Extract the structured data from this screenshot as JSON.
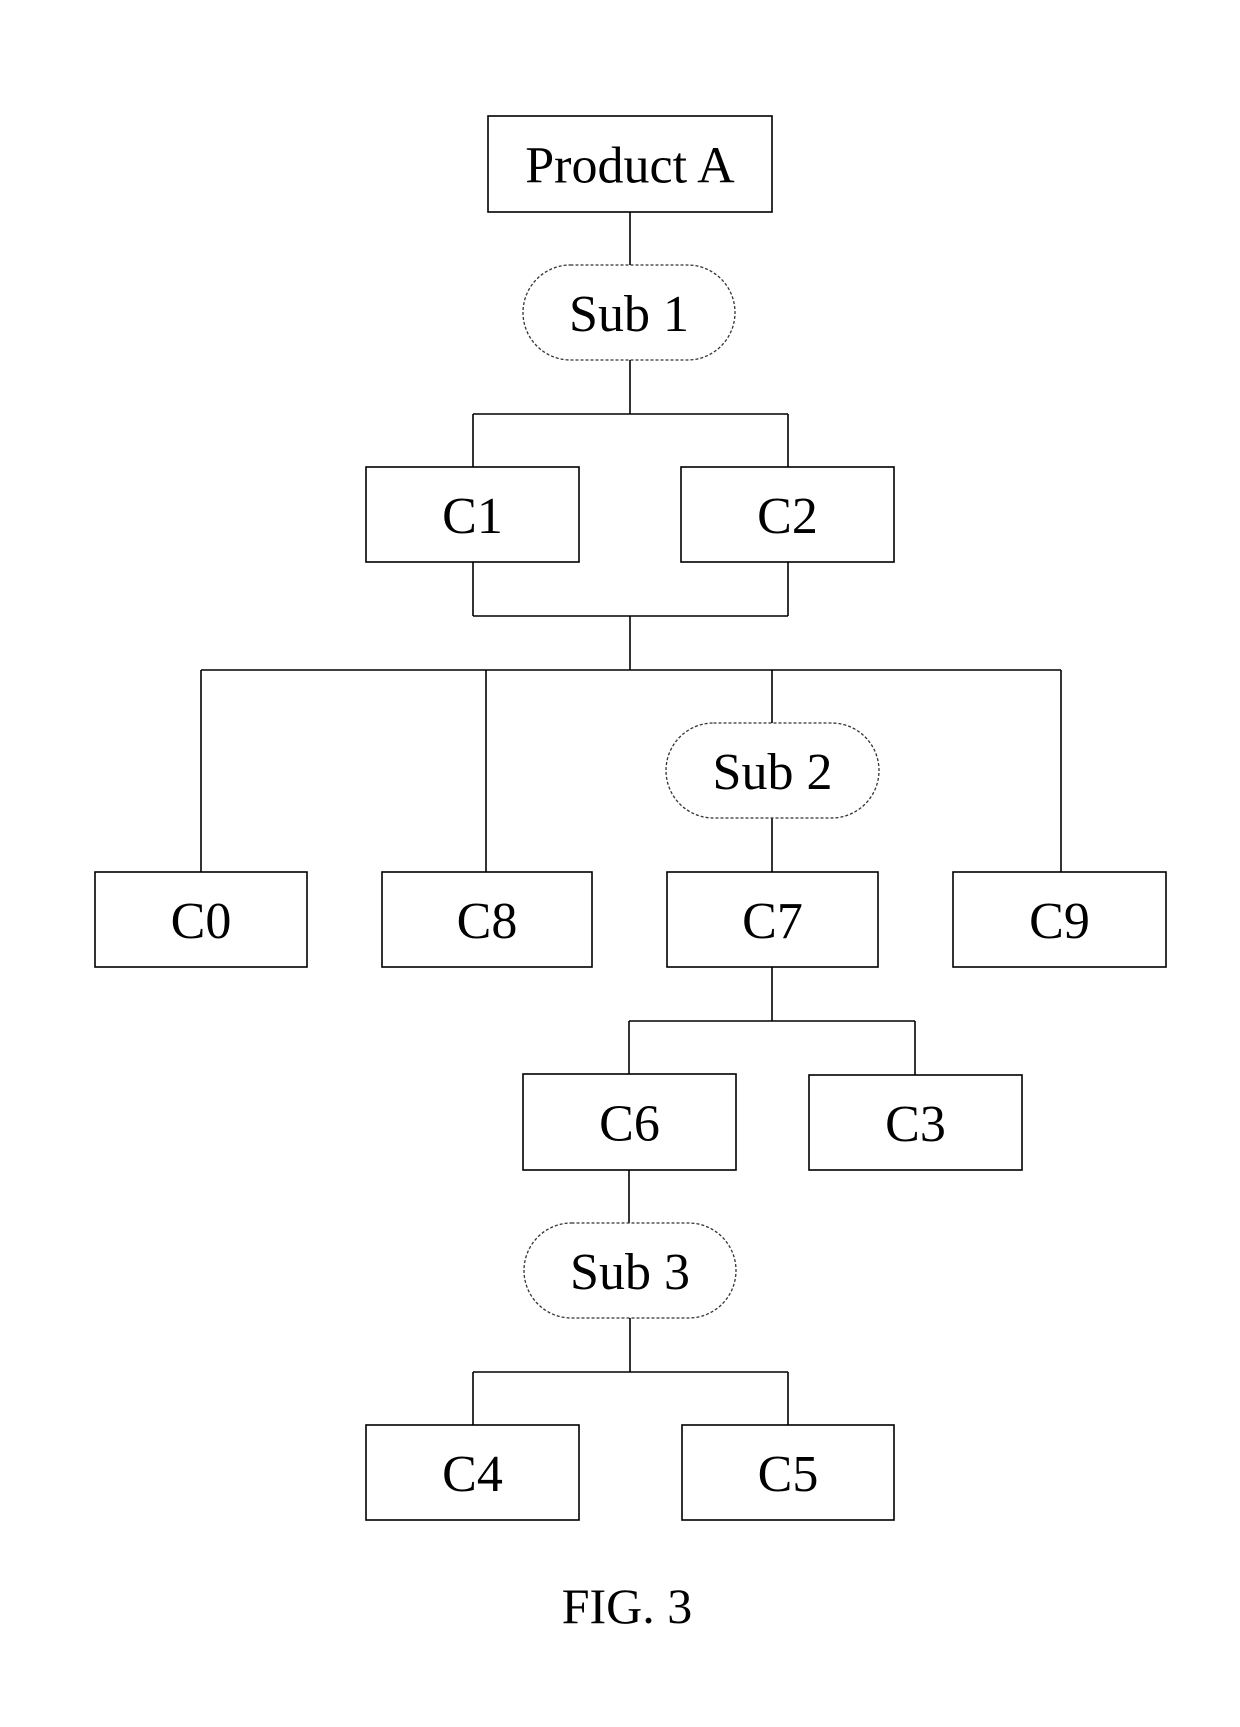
{
  "figure": {
    "caption": "FIG. 3",
    "root": "Product A"
  },
  "nodes": [
    {
      "id": "product_a",
      "label": "Product A",
      "shape": "box"
    },
    {
      "id": "sub1",
      "label": "Sub 1",
      "shape": "pill"
    },
    {
      "id": "c1",
      "label": "C1",
      "shape": "box"
    },
    {
      "id": "c2",
      "label": "C2",
      "shape": "box"
    },
    {
      "id": "c0",
      "label": "C0",
      "shape": "box"
    },
    {
      "id": "c8",
      "label": "C8",
      "shape": "box"
    },
    {
      "id": "sub2",
      "label": "Sub 2",
      "shape": "pill"
    },
    {
      "id": "c7",
      "label": "C7",
      "shape": "box"
    },
    {
      "id": "c9",
      "label": "C9",
      "shape": "box"
    },
    {
      "id": "c6",
      "label": "C6",
      "shape": "box"
    },
    {
      "id": "c3",
      "label": "C3",
      "shape": "box"
    },
    {
      "id": "sub3",
      "label": "Sub 3",
      "shape": "pill"
    },
    {
      "id": "c4",
      "label": "C4",
      "shape": "box"
    },
    {
      "id": "c5",
      "label": "C5",
      "shape": "box"
    }
  ],
  "edges": [
    {
      "from": "product_a",
      "to": [
        "sub1"
      ]
    },
    {
      "from": "sub1",
      "to": [
        "c1",
        "c2"
      ]
    },
    {
      "from": [
        "c1",
        "c2"
      ],
      "to": [
        "c0",
        "c8",
        "sub2",
        "c9"
      ]
    },
    {
      "from": "sub2",
      "to": [
        "c7"
      ]
    },
    {
      "from": "c7",
      "to": [
        "c6",
        "c3"
      ]
    },
    {
      "from": "c6",
      "to": [
        "sub3"
      ]
    },
    {
      "from": "sub3",
      "to": [
        "c4",
        "c5"
      ]
    }
  ]
}
